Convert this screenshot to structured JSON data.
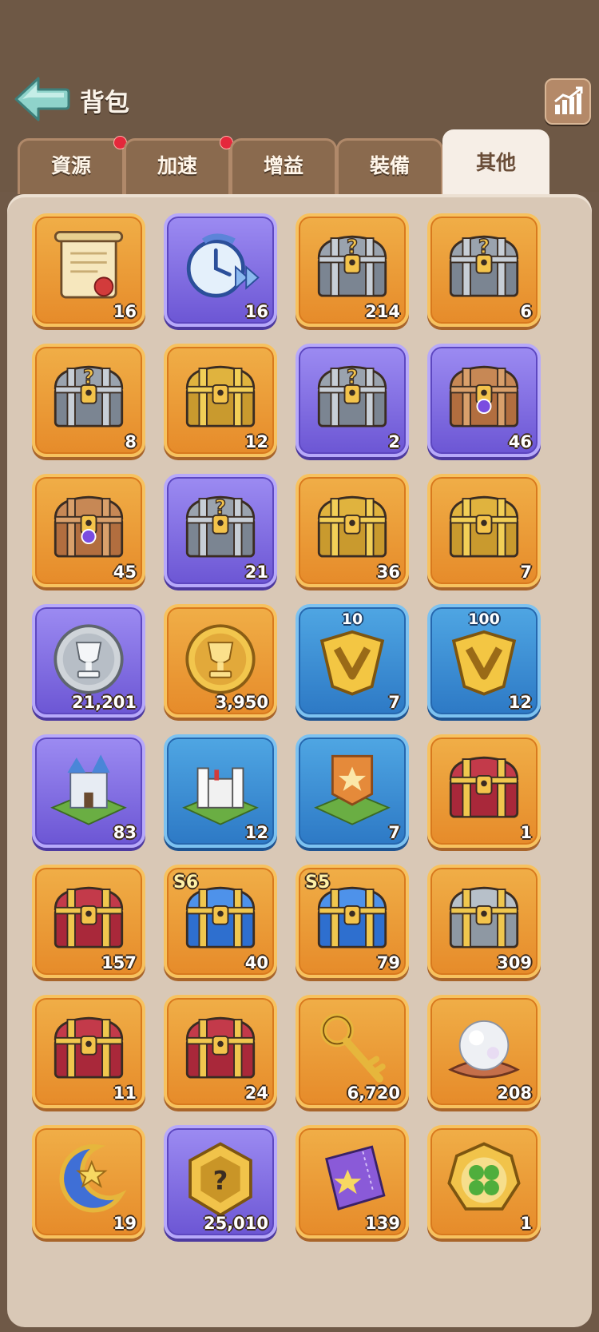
{
  "header": {
    "title": "背包"
  },
  "tabs": [
    {
      "label": "資源",
      "badge": true
    },
    {
      "label": "加速",
      "badge": true
    },
    {
      "label": "增益",
      "badge": false
    },
    {
      "label": "裝備",
      "badge": false
    },
    {
      "label": "其他",
      "badge": false,
      "active": true
    }
  ],
  "items": [
    {
      "icon": "scroll-icon",
      "bg": "orange",
      "count": "16"
    },
    {
      "icon": "speedup-clock-icon",
      "bg": "purple",
      "count": "16"
    },
    {
      "icon": "mystery-chest-icon",
      "bg": "orange",
      "count": "214"
    },
    {
      "icon": "mystery-chest-icon",
      "bg": "orange",
      "count": "6"
    },
    {
      "icon": "mystery-chest-icon",
      "bg": "orange",
      "count": "8"
    },
    {
      "icon": "gold-chest-icon",
      "bg": "orange",
      "count": "12"
    },
    {
      "icon": "mystery-chest-icon",
      "bg": "purple",
      "count": "2"
    },
    {
      "icon": "gem-chest-icon",
      "bg": "purple",
      "count": "46"
    },
    {
      "icon": "gem-chest-icon",
      "bg": "orange",
      "count": "45"
    },
    {
      "icon": "mystery-chest-icon",
      "bg": "purple",
      "count": "21"
    },
    {
      "icon": "gold-chest-icon",
      "bg": "orange",
      "count": "36"
    },
    {
      "icon": "gold-chest-icon",
      "bg": "orange",
      "count": "7"
    },
    {
      "icon": "silver-trophy-coin-icon",
      "bg": "purple",
      "count": "21,201"
    },
    {
      "icon": "gold-trophy-coin-icon",
      "bg": "orange",
      "count": "3,950"
    },
    {
      "icon": "vip-badge-icon",
      "bg": "blue",
      "count": "7",
      "label": "10"
    },
    {
      "icon": "vip-badge-icon",
      "bg": "blue",
      "count": "12",
      "label": "100"
    },
    {
      "icon": "castle-icon",
      "bg": "purple",
      "count": "83"
    },
    {
      "icon": "fortress-icon",
      "bg": "blue",
      "count": "12"
    },
    {
      "icon": "banner-icon",
      "bg": "blue",
      "count": "7"
    },
    {
      "icon": "red-chest-icon",
      "bg": "orange",
      "count": "1"
    },
    {
      "icon": "red-chest-icon",
      "bg": "orange",
      "count": "157"
    },
    {
      "icon": "blue-chest-icon",
      "bg": "orange",
      "count": "40",
      "season": "S6"
    },
    {
      "icon": "blue-chest-icon",
      "bg": "orange",
      "count": "79",
      "season": "S5"
    },
    {
      "icon": "silver-chest-icon",
      "bg": "orange",
      "count": "309"
    },
    {
      "icon": "red-chest-icon",
      "bg": "orange",
      "count": "11"
    },
    {
      "icon": "red-chest-icon",
      "bg": "orange",
      "count": "24"
    },
    {
      "icon": "key-icon",
      "bg": "orange",
      "count": "6,720"
    },
    {
      "icon": "pearl-icon",
      "bg": "orange",
      "count": "208"
    },
    {
      "icon": "moon-icon",
      "bg": "orange",
      "count": "19"
    },
    {
      "icon": "mystery-coin-icon",
      "bg": "purple",
      "count": "25,010"
    },
    {
      "icon": "ticket-icon",
      "bg": "orange",
      "count": "139"
    },
    {
      "icon": "clover-coin-icon",
      "bg": "orange",
      "count": "1"
    }
  ]
}
